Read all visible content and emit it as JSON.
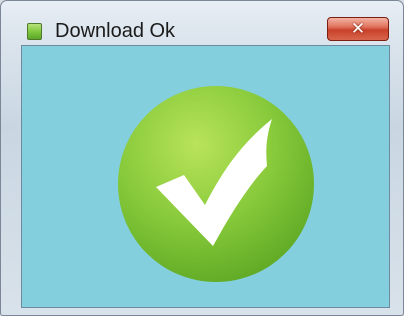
{
  "window": {
    "title": "Download Ok",
    "close_label": "✕",
    "title_icon": "app-icon",
    "close_icon": "close-icon"
  },
  "content": {
    "graphic_icon": "checkmark-success-icon",
    "background_color": "#83cfde",
    "circle_color": "#7cc63b",
    "check_color": "#ffffff"
  }
}
